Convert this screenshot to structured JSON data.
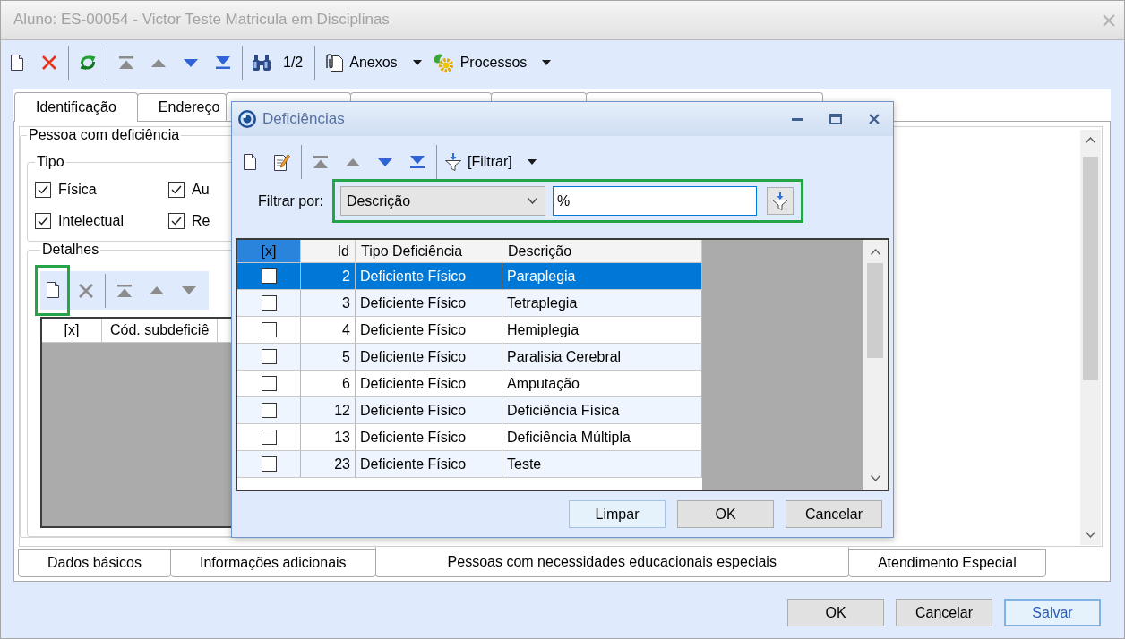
{
  "window": {
    "title": "Aluno: ES-00054 - Victor Teste Matricula em Disciplinas",
    "active": false
  },
  "toolbar": {
    "groups": [
      {
        "items": [
          {
            "kind": "new",
            "disabled": false
          },
          {
            "kind": "delete",
            "disabled": false
          }
        ]
      },
      {
        "items": [
          {
            "kind": "refresh",
            "disabled": false
          }
        ]
      },
      {
        "items": [
          {
            "kind": "first",
            "disabled": true
          },
          {
            "kind": "previous",
            "disabled": true
          },
          {
            "kind": "next",
            "disabled": false
          },
          {
            "kind": "last",
            "disabled": false
          }
        ]
      },
      {
        "items": [
          {
            "kind": "find",
            "disabled": false
          },
          {
            "kind": "counter",
            "label": "1/2",
            "disabled": false
          }
        ]
      },
      {
        "items": [
          {
            "kind": "attachments",
            "label": "Anexos",
            "disabled": false
          },
          {
            "kind": "processes",
            "label": "Processos",
            "disabled": false
          }
        ]
      }
    ]
  },
  "tabs": [
    {
      "label": "Identificação",
      "selected": true
    },
    {
      "label": "Endereço",
      "selected": false
    },
    {
      "selected": false
    },
    {
      "selected": false
    },
    {
      "selected": false
    },
    {
      "selected": false
    }
  ],
  "person_group": {
    "title": "Pessoa com deficiência",
    "type_group": {
      "title": "Tipo",
      "options": [
        {
          "label": "Física",
          "checked": true
        },
        {
          "label": "Au",
          "checked": true
        },
        {
          "label": "Intelectual",
          "checked": true
        },
        {
          "label": "Re",
          "checked": true
        }
      ]
    },
    "details": {
      "title": "Detalhes",
      "toolbar": {
        "groups": [
          {
            "items": [
              {
                "kind": "new",
                "disabled": false,
                "highlighted": true
              },
              {
                "kind": "delete",
                "disabled": true,
                "highlighted": false
              }
            ]
          },
          {
            "items": [
              {
                "kind": "first",
                "disabled": true,
                "highlighted": false
              },
              {
                "kind": "previous",
                "disabled": true,
                "highlighted": false
              },
              {
                "kind": "next",
                "disabled": true,
                "highlighted": false
              }
            ]
          }
        ]
      },
      "grid": {
        "columns": [
          "[x]",
          "Cód. subdeficiê"
        ]
      }
    }
  },
  "bottom_tabs": [
    {
      "label": "Dados básicos",
      "selected": false
    },
    {
      "label": "Informações adicionais",
      "selected": false
    },
    {
      "label": "Pessoas com necessidades educacionais especiais",
      "selected": true
    },
    {
      "label": "Atendimento Especial",
      "selected": false
    }
  ],
  "buttons": [
    {
      "label": "OK",
      "focused": false
    },
    {
      "label": "Cancelar",
      "focused": false
    },
    {
      "label": "Salvar",
      "focused": true
    }
  ],
  "dialog": {
    "title": "Deficiências",
    "toolbar": {
      "groups": [
        {
          "items": [
            {
              "kind": "new",
              "disabled": false
            },
            {
              "kind": "edit",
              "disabled": false
            }
          ]
        },
        {
          "items": [
            {
              "kind": "first",
              "disabled": true
            },
            {
              "kind": "previous",
              "disabled": true
            },
            {
              "kind": "next",
              "disabled": false
            },
            {
              "kind": "last",
              "disabled": false
            }
          ]
        },
        {
          "items": [
            {
              "kind": "filter",
              "label": "[Filtrar]",
              "disabled": false
            }
          ]
        }
      ]
    },
    "filter": {
      "label": "Filtrar por:",
      "field": "Descrição",
      "value": "%",
      "highlighted": true
    },
    "table": {
      "columns": [
        {
          "label": "[x]",
          "selected": true
        },
        {
          "label": "Id",
          "selected": false
        },
        {
          "label": "Tipo Deficiência",
          "selected": false
        },
        {
          "label": "Descrição",
          "selected": false
        }
      ],
      "rows": [
        {
          "checked": false,
          "selected": true,
          "id": "2",
          "type": "Deficiente Físico",
          "description": "Paraplegia"
        },
        {
          "checked": false,
          "selected": false,
          "id": "3",
          "type": "Deficiente Físico",
          "description": "Tetraplegia"
        },
        {
          "checked": false,
          "selected": false,
          "id": "4",
          "type": "Deficiente Físico",
          "description": "Hemiplegia"
        },
        {
          "checked": false,
          "selected": false,
          "id": "5",
          "type": "Deficiente Físico",
          "description": "Paralisia Cerebral"
        },
        {
          "checked": false,
          "selected": false,
          "id": "6",
          "type": "Deficiente Físico",
          "description": "Amputação"
        },
        {
          "checked": false,
          "selected": false,
          "id": "12",
          "type": "Deficiente Físico",
          "description": "Deficiência Física"
        },
        {
          "checked": false,
          "selected": false,
          "id": "13",
          "type": "Deficiente Físico",
          "description": "Deficiência Múltipla"
        },
        {
          "checked": false,
          "selected": false,
          "id": "23",
          "type": "Deficiente Físico",
          "description": "Teste"
        }
      ]
    },
    "buttons": [
      {
        "label": "Limpar",
        "focused": true
      },
      {
        "label": "OK",
        "focused": false
      },
      {
        "label": "Cancelar",
        "focused": false
      }
    ]
  }
}
